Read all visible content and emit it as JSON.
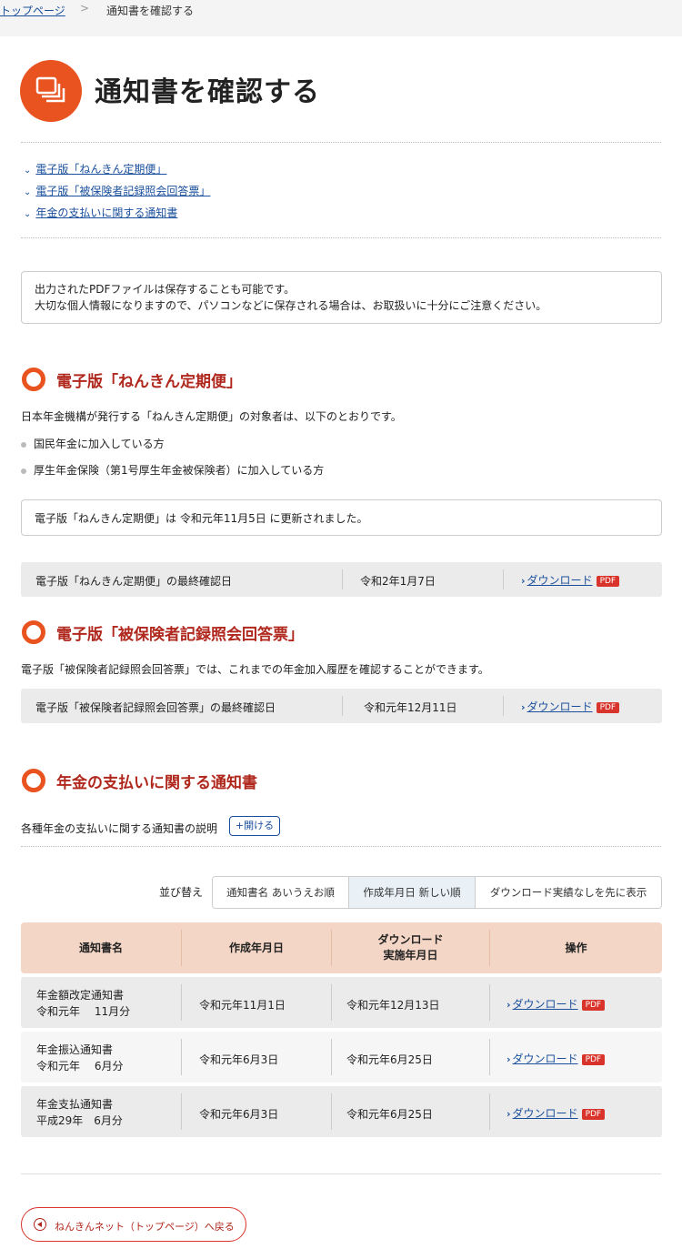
{
  "breadcrumb": {
    "home": "トップページ",
    "separator": ">",
    "current": "通知書を確認する"
  },
  "page": {
    "title": "通知書を確認する"
  },
  "anchors": [
    {
      "label": "電子版「ねんきん定期便」"
    },
    {
      "label": "電子版「被保険者記録照会回答票」"
    },
    {
      "label": "年金の支払いに関する通知書"
    }
  ],
  "notice": {
    "line1": "出力されたPDFファイルは保存することも可能です。",
    "line2": "大切な個人情報になりますので、パソコンなどに保存される場合は、お取扱いに十分にご注意ください。"
  },
  "section1": {
    "title": "電子版「ねんきん定期便」",
    "intro": "日本年金機構が発行する「ねんきん定期便」の対象者は、以下のとおりです。",
    "bullets": [
      "国民年金に加入している方",
      "厚生年金保険（第1号厚生年金被保険者）に加入している方"
    ],
    "update_note": "電子版「ねんきん定期便」は 令和元年11月5日 に更新されました。",
    "row": {
      "label": "電子版「ねんきん定期便」の最終確認日",
      "date": "令和2年1月7日",
      "download": "ダウンロード",
      "pdf": "PDF"
    }
  },
  "section2": {
    "title": "電子版「被保険者記録照会回答票」",
    "intro": "電子版「被保険者記録照会回答票」では、これまでの年金加入履歴を確認することができます。",
    "row": {
      "label": "電子版「被保険者記録照会回答票」の最終確認日",
      "date": "令和元年12月11日",
      "download": "ダウンロード",
      "pdf": "PDF"
    }
  },
  "section3": {
    "title": "年金の支払いに関する通知書",
    "desc": "各種年金の支払いに関する通知書の説明",
    "open_button": "開ける",
    "sort_label": "並び替え",
    "sort_options": [
      "通知書名 あいうえお順",
      "作成年月日 新しい順",
      "ダウンロード実績なしを先に表示"
    ],
    "table": {
      "headers": {
        "name": "通知書名",
        "created": "作成年月日",
        "download_line1": "ダウンロード",
        "download_line2": "実施年月日",
        "action": "操作"
      },
      "rows": [
        {
          "name": "年金額改定通知書",
          "period": "令和元年　 11月分",
          "created": "令和元年11月1日",
          "downloaded": "令和元年12月13日",
          "download": "ダウンロード",
          "pdf": "PDF"
        },
        {
          "name": "年金振込通知書",
          "period": "令和元年　 6月分",
          "created": "令和元年6月3日",
          "downloaded": "令和元年6月25日",
          "download": "ダウンロード",
          "pdf": "PDF"
        },
        {
          "name": "年金支払通知書",
          "period": "平成29年　6月分",
          "created": "令和元年6月3日",
          "downloaded": "令和元年6月25日",
          "download": "ダウンロード",
          "pdf": "PDF"
        }
      ]
    }
  },
  "back_button": "ねんきんネット（トップページ）へ戻る"
}
